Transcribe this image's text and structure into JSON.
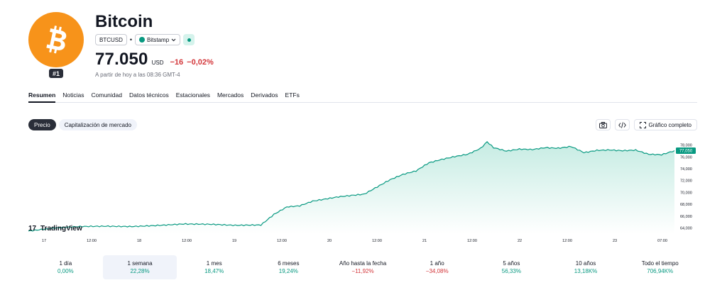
{
  "header": {
    "title": "Bitcoin",
    "rank": "#1",
    "symbol": "BTCUSD",
    "exchange": "Bitstamp",
    "price": "77.050",
    "currency": "USD",
    "change": "−16",
    "change_pct": "−0,02%",
    "as_of": "A partir de hoy a las 08:36 GMT-4"
  },
  "tabs": [
    "Resumen",
    "Noticias",
    "Comunidad",
    "Datos técnicos",
    "Estacionales",
    "Mercados",
    "Derivados",
    "ETFs"
  ],
  "chart_tabs": [
    "Precio",
    "Capitalización de mercado"
  ],
  "toolbar": {
    "camera_icon": "camera-icon",
    "embed_icon": "code-icon",
    "fullscreen_label": "Gráfico completo"
  },
  "chart_data": {
    "type": "area",
    "brand": "TradingView",
    "x_ticks": [
      "17",
      "12:00",
      "18",
      "12:00",
      "19",
      "12:00",
      "20",
      "12:00",
      "21",
      "12:00",
      "22",
      "12:00",
      "23",
      "07:00"
    ],
    "y_ticks": [
      "78,000",
      "76,000",
      "74,000",
      "72,000",
      "70,000",
      "68,000",
      "66,000",
      "64,000"
    ],
    "last_price_label": "77,050",
    "ylim": [
      63000,
      79500
    ],
    "x": [
      0,
      4,
      8,
      12,
      16,
      20,
      24,
      28,
      32,
      36,
      38,
      40,
      42,
      44,
      48,
      52,
      56,
      58,
      60,
      62,
      64,
      66,
      68,
      70,
      71,
      72,
      74,
      76,
      78,
      80,
      82,
      84,
      86,
      88,
      90,
      92,
      94,
      96,
      98,
      100
    ],
    "y": [
      63500,
      63950,
      64200,
      64300,
      64300,
      64500,
      64700,
      64600,
      64400,
      64500,
      66300,
      67600,
      67800,
      68600,
      69300,
      69700,
      72100,
      73000,
      73600,
      75000,
      75600,
      76100,
      76500,
      77500,
      78600,
      77600,
      77000,
      77300,
      77200,
      77500,
      77400,
      77700,
      76700,
      77100,
      77200,
      77100,
      77200,
      76500,
      76400,
      77050
    ],
    "colors": {
      "line": "#089981",
      "fill_top": "#c6ece3",
      "fill_bottom": "#ffffff"
    }
  },
  "periods": [
    {
      "label": "1 día",
      "value": "0,00%",
      "sign": "pos"
    },
    {
      "label": "1 semana",
      "value": "22,28%",
      "sign": "pos",
      "active": true
    },
    {
      "label": "1 mes",
      "value": "18,47%",
      "sign": "pos"
    },
    {
      "label": "6 meses",
      "value": "19,24%",
      "sign": "pos"
    },
    {
      "label": "Año hasta la fecha",
      "value": "−11,92%",
      "sign": "neg"
    },
    {
      "label": "1 año",
      "value": "−34,08%",
      "sign": "neg"
    },
    {
      "label": "5 años",
      "value": "56,33%",
      "sign": "pos"
    },
    {
      "label": "10 años",
      "value": "13,18K%",
      "sign": "pos"
    },
    {
      "label": "Todo el tiempo",
      "value": "706,94K%",
      "sign": "pos"
    }
  ]
}
